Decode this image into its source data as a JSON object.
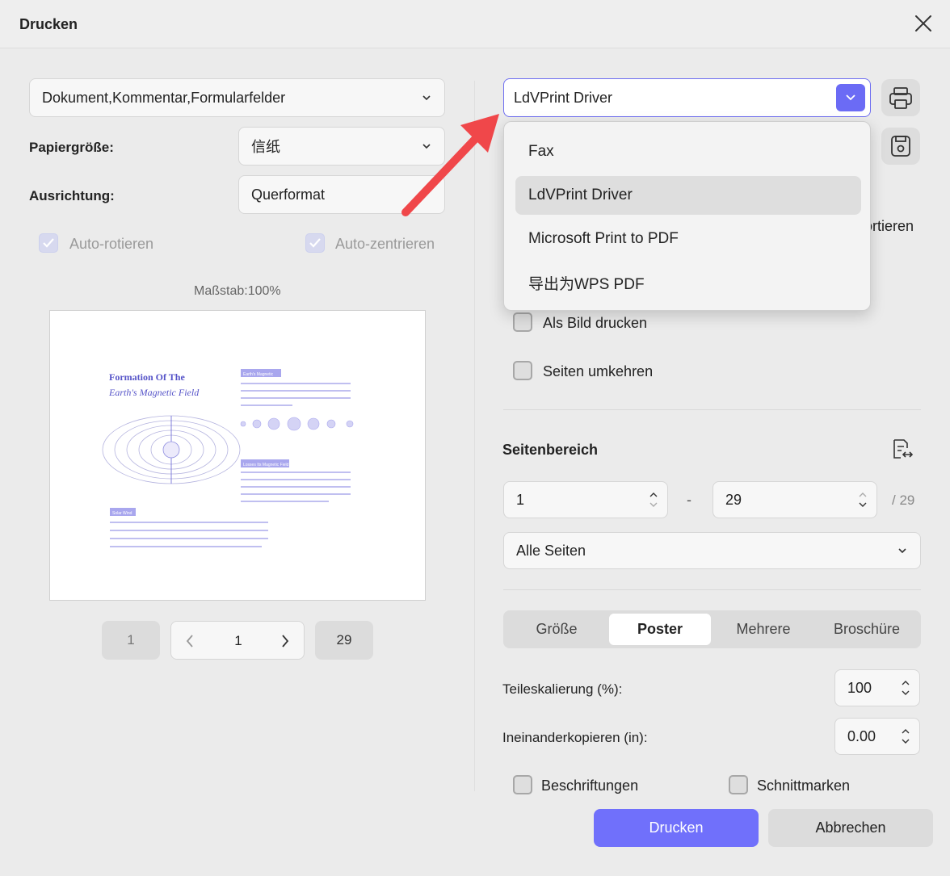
{
  "dialog": {
    "title": "Drucken"
  },
  "left": {
    "content_select": "Dokument,Kommentar,Formularfelder",
    "paper_size": {
      "label": "Papiergröße:",
      "value": "信纸"
    },
    "orientation": {
      "label": "Ausrichtung:",
      "value": "Querformat"
    },
    "auto_rotate": {
      "label": "Auto-rotieren",
      "checked": true
    },
    "auto_center": {
      "label": "Auto-zentrieren",
      "checked": true
    },
    "scale": "Maßstab:100%",
    "preview": {
      "title_line1": "Formation Of The",
      "title_line2": "Earth's Magnetic Field",
      "tag1": "Earth's Magnetic",
      "tag2": "Losses Its Magnetic Field",
      "tag3": "Solar Wind"
    },
    "pager": {
      "first": "1",
      "current": "1",
      "last": "29"
    }
  },
  "right": {
    "printer": {
      "selected": "LdVPrint Driver"
    },
    "printer_options": [
      "Fax",
      "LdVPrint Driver",
      "Microsoft Print to PDF",
      "导出为WPS PDF"
    ],
    "hidden_text_partial": "ortieren",
    "print_as_image": {
      "label": "Als Bild drucken",
      "checked": false
    },
    "reverse_pages": {
      "label": "Seiten umkehren",
      "checked": false
    },
    "page_range": {
      "heading": "Seitenbereich",
      "from": "1",
      "dash": "-",
      "to": "29",
      "total": "/ 29",
      "subset": "Alle Seiten"
    },
    "tabs": [
      "Größe",
      "Poster",
      "Mehrere",
      "Broschüre"
    ],
    "active_tab": "Poster",
    "tile_scale": {
      "label": "Teileskalierung (%):",
      "value": "100"
    },
    "overlap": {
      "label": "Ineinanderkopieren (in):",
      "value": "0.00"
    },
    "labels_cb": {
      "label": "Beschriftungen",
      "checked": false
    },
    "cut_marks_cb": {
      "label": "Schnittmarken",
      "checked": false
    }
  },
  "buttons": {
    "print": "Drucken",
    "cancel": "Abbrechen"
  },
  "colors": {
    "accent": "#7070fb",
    "annotation_arrow": "#f0474a"
  }
}
